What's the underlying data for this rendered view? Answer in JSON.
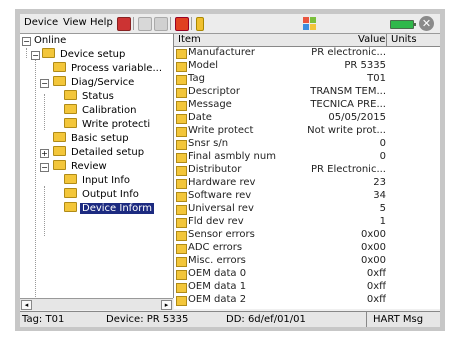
{
  "menu": [
    "Device",
    "View",
    "Help"
  ],
  "tree": {
    "items": [
      {
        "label": "Online",
        "level": 0
      },
      {
        "label": "Device setup",
        "level": 1
      },
      {
        "label": "Process variable...",
        "level": 2
      },
      {
        "label": "Diag/Service",
        "level": 2
      },
      {
        "label": "Status",
        "level": 3
      },
      {
        "label": "Calibration",
        "level": 3
      },
      {
        "label": "Write protecti",
        "level": 3
      },
      {
        "label": "Basic setup",
        "level": 2
      },
      {
        "label": "Detailed setup",
        "level": 2
      },
      {
        "label": "Review",
        "level": 2
      },
      {
        "label": "Input Info",
        "level": 3
      },
      {
        "label": "Output Info",
        "level": 3
      },
      {
        "label": "Device Inform",
        "level": 3,
        "selected": true
      }
    ]
  },
  "grid": {
    "headers": {
      "item": "Item",
      "value": "Value",
      "units": "Units"
    },
    "rows": [
      {
        "item": "Manufacturer",
        "value": "PR electronic...",
        "icon": "doc"
      },
      {
        "item": "Model",
        "value": "PR 5335",
        "icon": "doc"
      },
      {
        "item": "Tag",
        "value": "T01",
        "icon": "doc"
      },
      {
        "item": "Descriptor",
        "value": "TRANSM TEM...",
        "icon": "doc"
      },
      {
        "item": "Message",
        "value": "TECNICA PRE...",
        "icon": "doc"
      },
      {
        "item": "Date",
        "value": "05/05/2015",
        "icon": "doc"
      },
      {
        "item": "Write protect",
        "value": "Not write prot...",
        "icon": "var"
      },
      {
        "item": "Snsr s/n",
        "value": "0",
        "icon": "doc"
      },
      {
        "item": "Final asmbly num",
        "value": "0",
        "icon": "doc"
      },
      {
        "item": "Distributor",
        "value": "PR Electronic...",
        "icon": "doc"
      },
      {
        "item": "Hardware rev",
        "value": "23",
        "icon": "var"
      },
      {
        "item": "Software rev",
        "value": "34",
        "icon": "var"
      },
      {
        "item": "Universal rev",
        "value": "5",
        "icon": "var"
      },
      {
        "item": "Fld dev rev",
        "value": "1",
        "icon": "var"
      },
      {
        "item": "Sensor errors",
        "value": "0x00",
        "icon": "var"
      },
      {
        "item": "ADC errors",
        "value": "0x00",
        "icon": "var"
      },
      {
        "item": "Misc. errors",
        "value": "0x00",
        "icon": "var"
      },
      {
        "item": "OEM data 0",
        "value": "0xff",
        "icon": "var"
      },
      {
        "item": "OEM data 1",
        "value": "0xff",
        "icon": "var"
      },
      {
        "item": "OEM data 2",
        "value": "0xff",
        "icon": "var"
      }
    ]
  },
  "status": {
    "tag": "Tag: T01",
    "device": "Device: PR 5335",
    "dd": "DD: 6d/ef/01/01",
    "msg": "HART Msg"
  },
  "colors": {
    "selection": "#1c2a80",
    "folder": "#f3c63a",
    "battery": "#2fb84a"
  }
}
